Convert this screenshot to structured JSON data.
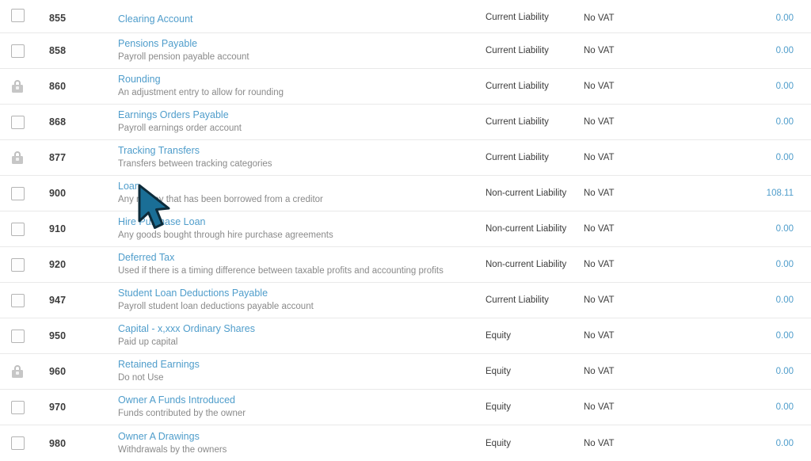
{
  "app": {
    "screen": "chart-of-accounts-list"
  },
  "icons": {
    "checkbox": "checkbox-icon",
    "lock": "lock-icon",
    "cursor": "mouse-cursor-arrow"
  },
  "colors": {
    "link": "#4f9dcb",
    "text": "#3c3c3c",
    "muted": "#8a8a8a",
    "row_divider": "#e9e9e9",
    "cursor_fill": "#1a6e96",
    "cursor_outline": "#0e2d3d",
    "background": "#ffffff"
  },
  "rows": [
    {
      "select_type": "checkbox",
      "code": "855",
      "name": "Clearing Account",
      "description": "",
      "type": "Current Liability",
      "tax": "No VAT",
      "balance": "0.00",
      "clipped": true
    },
    {
      "select_type": "checkbox",
      "code": "858",
      "name": "Pensions Payable",
      "description": "Payroll pension payable account",
      "type": "Current Liability",
      "tax": "No VAT",
      "balance": "0.00",
      "clipped": false
    },
    {
      "select_type": "lock",
      "code": "860",
      "name": "Rounding",
      "description": "An adjustment entry to allow for rounding",
      "type": "Current Liability",
      "tax": "No VAT",
      "balance": "0.00",
      "clipped": false
    },
    {
      "select_type": "checkbox",
      "code": "868",
      "name": "Earnings Orders Payable",
      "description": "Payroll earnings order account",
      "type": "Current Liability",
      "tax": "No VAT",
      "balance": "0.00",
      "clipped": false
    },
    {
      "select_type": "lock",
      "code": "877",
      "name": "Tracking Transfers",
      "description": "Transfers between tracking categories",
      "type": "Current Liability",
      "tax": "No VAT",
      "balance": "0.00",
      "clipped": false
    },
    {
      "select_type": "checkbox",
      "code": "900",
      "name": "Loan",
      "description": "Any money that has been borrowed from a creditor",
      "type": "Non-current Liability",
      "tax": "No VAT",
      "balance": "108.11",
      "clipped": false
    },
    {
      "select_type": "checkbox",
      "code": "910",
      "name": "Hire Purchase Loan",
      "description": "Any goods bought through hire purchase agreements",
      "type": "Non-current Liability",
      "tax": "No VAT",
      "balance": "0.00",
      "clipped": false
    },
    {
      "select_type": "checkbox",
      "code": "920",
      "name": "Deferred Tax",
      "description": "Used if there is a timing difference between taxable profits and accounting profits",
      "type": "Non-current Liability",
      "tax": "No VAT",
      "balance": "0.00",
      "clipped": false
    },
    {
      "select_type": "checkbox",
      "code": "947",
      "name": "Student Loan Deductions Payable",
      "description": "Payroll student loan deductions payable account",
      "type": "Current Liability",
      "tax": "No VAT",
      "balance": "0.00",
      "clipped": false
    },
    {
      "select_type": "checkbox",
      "code": "950",
      "name": "Capital - x,xxx Ordinary Shares",
      "description": "Paid up capital",
      "type": "Equity",
      "tax": "No VAT",
      "balance": "0.00",
      "clipped": false
    },
    {
      "select_type": "lock",
      "code": "960",
      "name": "Retained Earnings",
      "description": "Do not Use",
      "type": "Equity",
      "tax": "No VAT",
      "balance": "0.00",
      "clipped": false
    },
    {
      "select_type": "checkbox",
      "code": "970",
      "name": "Owner A Funds Introduced",
      "description": "Funds contributed by the owner",
      "type": "Equity",
      "tax": "No VAT",
      "balance": "0.00",
      "clipped": false
    },
    {
      "select_type": "checkbox",
      "code": "980",
      "name": "Owner A Drawings",
      "description": "Withdrawals by the owners",
      "type": "Equity",
      "tax": "No VAT",
      "balance": "0.00",
      "clipped": false
    }
  ]
}
